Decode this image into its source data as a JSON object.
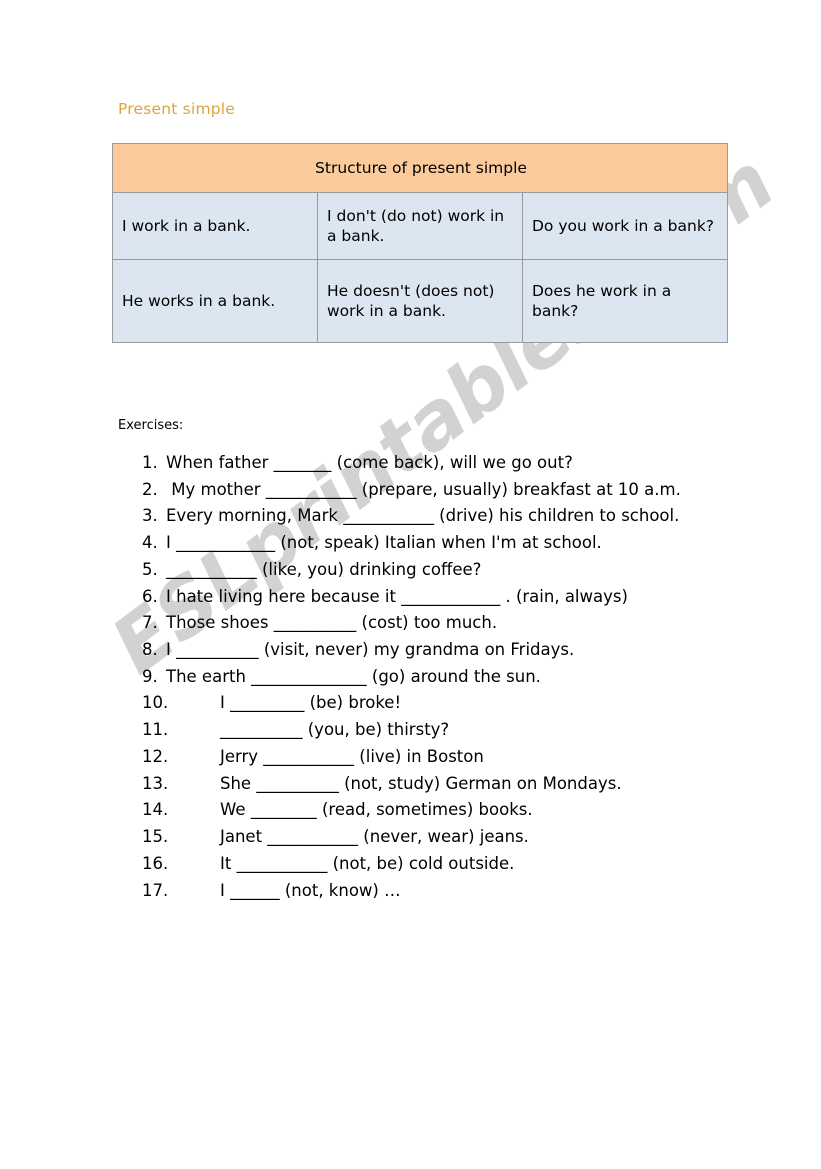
{
  "document": {
    "title": "Present simple",
    "watermark": "ESLprintables.com",
    "title_color": "#e0a33c",
    "header_fill": "#fbcb9b",
    "cell_fill": "#dce6f1",
    "border_color": "#9a9a9a"
  },
  "structure_table": {
    "header": "Structure of present simple",
    "rows": [
      {
        "affirmative": "I work in a bank.",
        "negative": "I don't (do not) work in a bank.",
        "question": "Do you work in a bank?"
      },
      {
        "affirmative": "He works in a bank.",
        "negative": "He doesn't (does not) work in a bank.",
        "question": " Does he work in a bank?"
      }
    ]
  },
  "exercises": {
    "label": "Exercises:",
    "items": [
      {
        "number": "1.",
        "text": "When father _______ (come back), will we go out?",
        "wide_gap": false
      },
      {
        "number": "2.",
        "text": " My mother ___________ (prepare, usually) breakfast at 10 a.m.",
        "wide_gap": false
      },
      {
        "number": "3.",
        "text": "Every morning, Mark ___________ (drive) his children to school.",
        "wide_gap": false
      },
      {
        "number": "4.",
        "text": "I ____________ (not, speak) Italian when I'm at school.",
        "wide_gap": false
      },
      {
        "number": "5.",
        "text": "___________ (like, you) drinking coffee?",
        "wide_gap": false
      },
      {
        "number": "6.",
        "text": "I hate living here because it ____________ . (rain, always)",
        "wide_gap": false
      },
      {
        "number": "7.",
        "text": "Those shoes __________ (cost) too much.",
        "wide_gap": false
      },
      {
        "number": "8.",
        "text": "I __________ (visit, never) my grandma on Fridays.",
        "wide_gap": false
      },
      {
        "number": "9.",
        "text": "The earth ______________ (go) around the sun.",
        "wide_gap": false
      },
      {
        "number": "10.",
        "text": "I _________ (be) broke!",
        "wide_gap": true
      },
      {
        "number": "11.",
        "text": "__________ (you, be) thirsty?",
        "wide_gap": true
      },
      {
        "number": "12.",
        "text": "Jerry ___________ (live) in Boston",
        "wide_gap": true
      },
      {
        "number": "13.",
        "text": "She __________ (not, study) German on Mondays.",
        "wide_gap": true
      },
      {
        "number": "14.",
        "text": "We ________ (read, sometimes) books.",
        "wide_gap": true
      },
      {
        "number": "15.",
        "text": "Janet ___________ (never, wear) jeans.",
        "wide_gap": true
      },
      {
        "number": "16.",
        "text": "It ___________ (not, be) cold outside.",
        "wide_gap": true
      },
      {
        "number": "17.",
        "text": "I ______ (not, know) …",
        "wide_gap": true
      }
    ]
  }
}
